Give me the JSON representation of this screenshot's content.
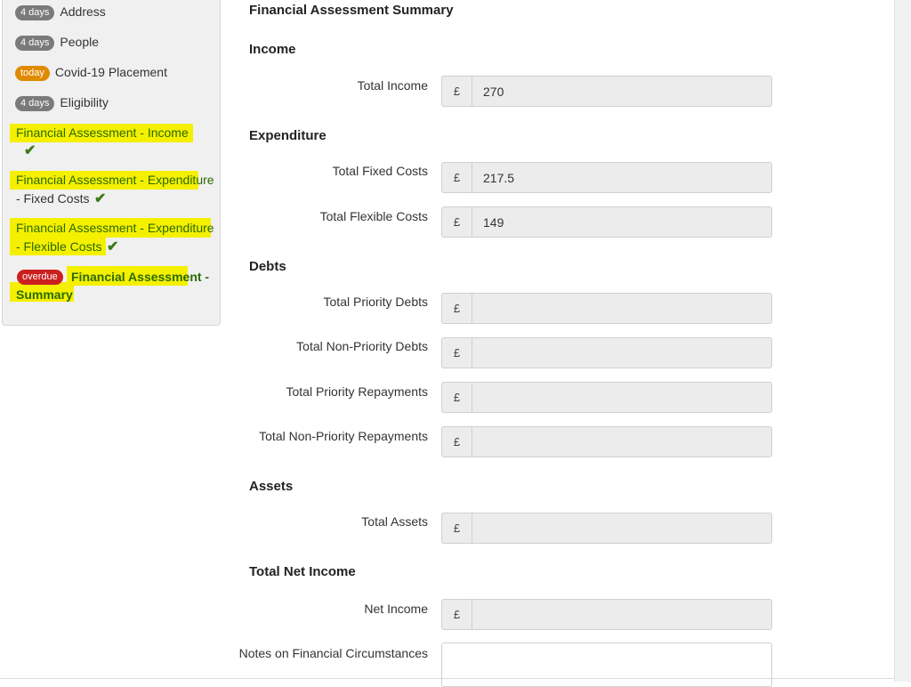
{
  "sidebar": {
    "items": [
      {
        "badge": "4 days",
        "label": "Address"
      },
      {
        "badge": "4 days",
        "label": "People"
      },
      {
        "badge": "today",
        "label": "Covid-19 Placement"
      },
      {
        "badge": "4 days",
        "label": "Eligibility"
      }
    ],
    "income": {
      "label": "Financial Assessment - Income"
    },
    "fixed": {
      "line1": "Financial Assessment - Expenditure",
      "line2": "- Fixed Costs"
    },
    "flexible": {
      "line1": "Financial Assessment - Expenditure",
      "line2": "- Flexible Costs"
    },
    "summary": {
      "badge": "overdue",
      "line1": "Financial Assessment -",
      "line2": "Summary"
    },
    "check_glyph": "✔",
    "colors": {
      "highlight": "#f4f000",
      "overdue": "#cc1f1f",
      "today": "#e08a00",
      "check": "#3c7a17"
    }
  },
  "main": {
    "title": "Financial Assessment Summary",
    "currency": "£",
    "sections": {
      "income": "Income",
      "expenditure": "Expenditure",
      "debts": "Debts",
      "assets": "Assets",
      "net": "Total Net Income"
    },
    "fields": {
      "total_income": {
        "label": "Total Income",
        "value": "270"
      },
      "total_fixed": {
        "label": "Total Fixed Costs",
        "value": "217.5"
      },
      "total_flexible": {
        "label": "Total Flexible Costs",
        "value": "149"
      },
      "priority_debts": {
        "label": "Total Priority Debts",
        "value": ""
      },
      "nonpriority_debts": {
        "label": "Total Non-Priority Debts",
        "value": ""
      },
      "priority_repay": {
        "label": "Total Priority Repayments",
        "value": ""
      },
      "nonpriority_repay": {
        "label": "Total Non-Priority Repayments",
        "value": ""
      },
      "total_assets": {
        "label": "Total Assets",
        "value": ""
      },
      "net_income": {
        "label": "Net Income",
        "value": ""
      }
    },
    "notes_label": "Notes on Financial Circumstances"
  }
}
